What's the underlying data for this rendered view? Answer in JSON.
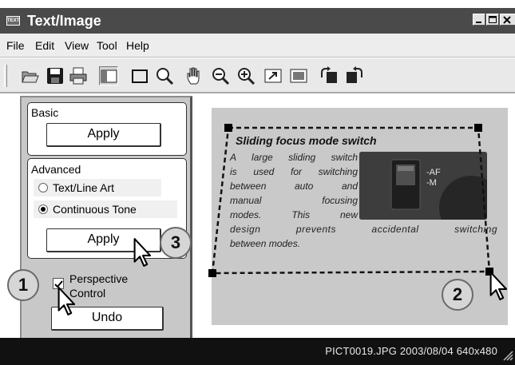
{
  "window": {
    "title": "Text/Image",
    "app_icon_text": "TEXT"
  },
  "menubar": {
    "items": [
      "File",
      "Edit",
      "View",
      "Tool",
      "Help"
    ]
  },
  "toolbar": {
    "tools": [
      "open-icon",
      "save-icon",
      "print-icon",
      "panel-toggle-icon",
      "crop-rectangle-icon",
      "zoom-icon",
      "hand-icon",
      "zoom-out-icon",
      "zoom-in-icon",
      "fit-window-icon",
      "full-screen-icon",
      "rotate-left-icon",
      "rotate-right-icon"
    ]
  },
  "left_panel": {
    "basic": {
      "label": "Basic",
      "apply_label": "Apply"
    },
    "advanced": {
      "label": "Advanced",
      "options": [
        {
          "label": "Text/Line Art",
          "selected": false
        },
        {
          "label": "Continuous Tone",
          "selected": true
        }
      ],
      "apply_label": "Apply"
    },
    "perspective": {
      "label_line1": "Perspective",
      "label_line2": "Control",
      "checked": true
    },
    "undo_label": "Undo"
  },
  "photo": {
    "title": "Sliding focus mode switch",
    "lines": [
      "A large sliding switch",
      "is used for switching",
      "between auto and",
      "manual focusing",
      "modes. This new",
      "design prevents accidental switching",
      "between modes."
    ],
    "camera_labels": [
      "-AF",
      "-M"
    ]
  },
  "status": {
    "text": "PICT0019.JPG 2003/08/04 640x480"
  },
  "callouts": [
    "1",
    "2",
    "3"
  ]
}
